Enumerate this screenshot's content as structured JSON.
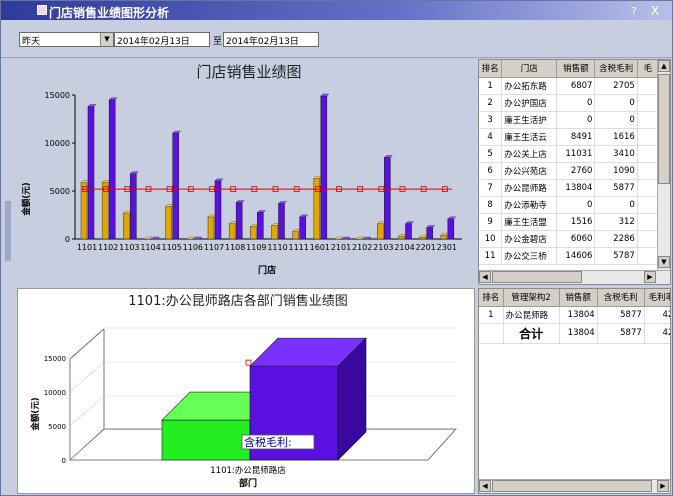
{
  "window": {
    "title": "门店销售业绩图形分析",
    "help_label": "?",
    "close_label": "X"
  },
  "filter": {
    "period": "昨天",
    "date_from": "2014年02月13日",
    "to_label": "至",
    "date_to": "2014年02月13日"
  },
  "top_chart": {
    "title": "门店销售业绩图",
    "ylabel": "金额(元)",
    "xlabel": "门店",
    "y_ticks": [
      "15000",
      "10000",
      "5000",
      "0"
    ]
  },
  "chart_data": [
    {
      "type": "bar",
      "title": "门店销售业绩图",
      "xlabel": "门店",
      "ylabel": "金额(元)",
      "ylim": [
        0,
        15000
      ],
      "categories": [
        "1101",
        "1102",
        "1103",
        "1104",
        "1105",
        "1106",
        "1107",
        "1108",
        "1109",
        "1110",
        "1111",
        "1601",
        "2101",
        "2102",
        "2103",
        "2104",
        "2201",
        "2301"
      ],
      "series": [
        {
          "values": [
            5877,
            5900,
            2700,
            0,
            3400,
            0,
            2300,
            1600,
            1300,
            1400,
            800,
            6300,
            0,
            0,
            1600,
            300,
            200,
            400
          ]
        },
        {
          "values": [
            13804,
            14500,
            6800,
            0,
            11031,
            0,
            6060,
            3800,
            2760,
            3700,
            2300,
            14900,
            0,
            0,
            8491,
            1600,
            1200,
            2100
          ]
        }
      ],
      "reference_line": 5200,
      "colors": {
        "bar_gold": "#e0a800",
        "bar_purple": "#5a10e0",
        "ref_line": "#e00000"
      }
    },
    {
      "type": "bar",
      "title": "1101:办公昆师路店各部门销售业绩图",
      "xlabel": "部门",
      "ylabel": "金额(元)",
      "ylim": [
        0,
        15000
      ],
      "categories": [
        "1101:办公昆师路店"
      ],
      "series": [
        {
          "values": [
            5877
          ]
        },
        {
          "values": [
            13804
          ]
        }
      ],
      "colors": {
        "bar_green": "#22ee22",
        "bar_purple": "#5a10e0"
      }
    }
  ],
  "top_grid": {
    "headers": [
      "排名",
      "门店",
      "销售额",
      "含税毛利",
      "毛"
    ],
    "rows": [
      [
        "1",
        "办公拓东路",
        "6807",
        "2705"
      ],
      [
        "2",
        "办公护国店",
        "0",
        "0"
      ],
      [
        "3",
        "廉王生活护",
        "0",
        "0"
      ],
      [
        "4",
        "廉王生活云",
        "8491",
        "1616"
      ],
      [
        "5",
        "办公关上店",
        "11031",
        "3410"
      ],
      [
        "6",
        "办公兴苑店",
        "2760",
        "1090"
      ],
      [
        "7",
        "办公昆师路",
        "13804",
        "5877"
      ],
      [
        "8",
        "办公添勒寺",
        "0",
        "0"
      ],
      [
        "9",
        "廉王生活盟",
        "1516",
        "312"
      ],
      [
        "10",
        "办公金碧店",
        "6060",
        "2286"
      ],
      [
        "11",
        "办公交三桥",
        "14606",
        "5787"
      ]
    ]
  },
  "bottom_chart": {
    "title": "1101:办公昆师路店各部门销售业绩图",
    "ylabel": "金额(元)",
    "xlabel": "部门",
    "category": "1101:办公昆师路店",
    "y_ticks": [
      "15000",
      "10000",
      "5000",
      "0"
    ],
    "tooltip": "含税毛利:"
  },
  "bottom_grid": {
    "headers": [
      "排名",
      "管理架构2",
      "销售额",
      "含税毛利",
      "毛利率"
    ],
    "rows": [
      [
        "1",
        "办公昆师路",
        "13804",
        "5877",
        "42."
      ]
    ],
    "total": {
      "label": "合计",
      "sales": "13804",
      "profit": "5877",
      "rate": "42."
    }
  }
}
